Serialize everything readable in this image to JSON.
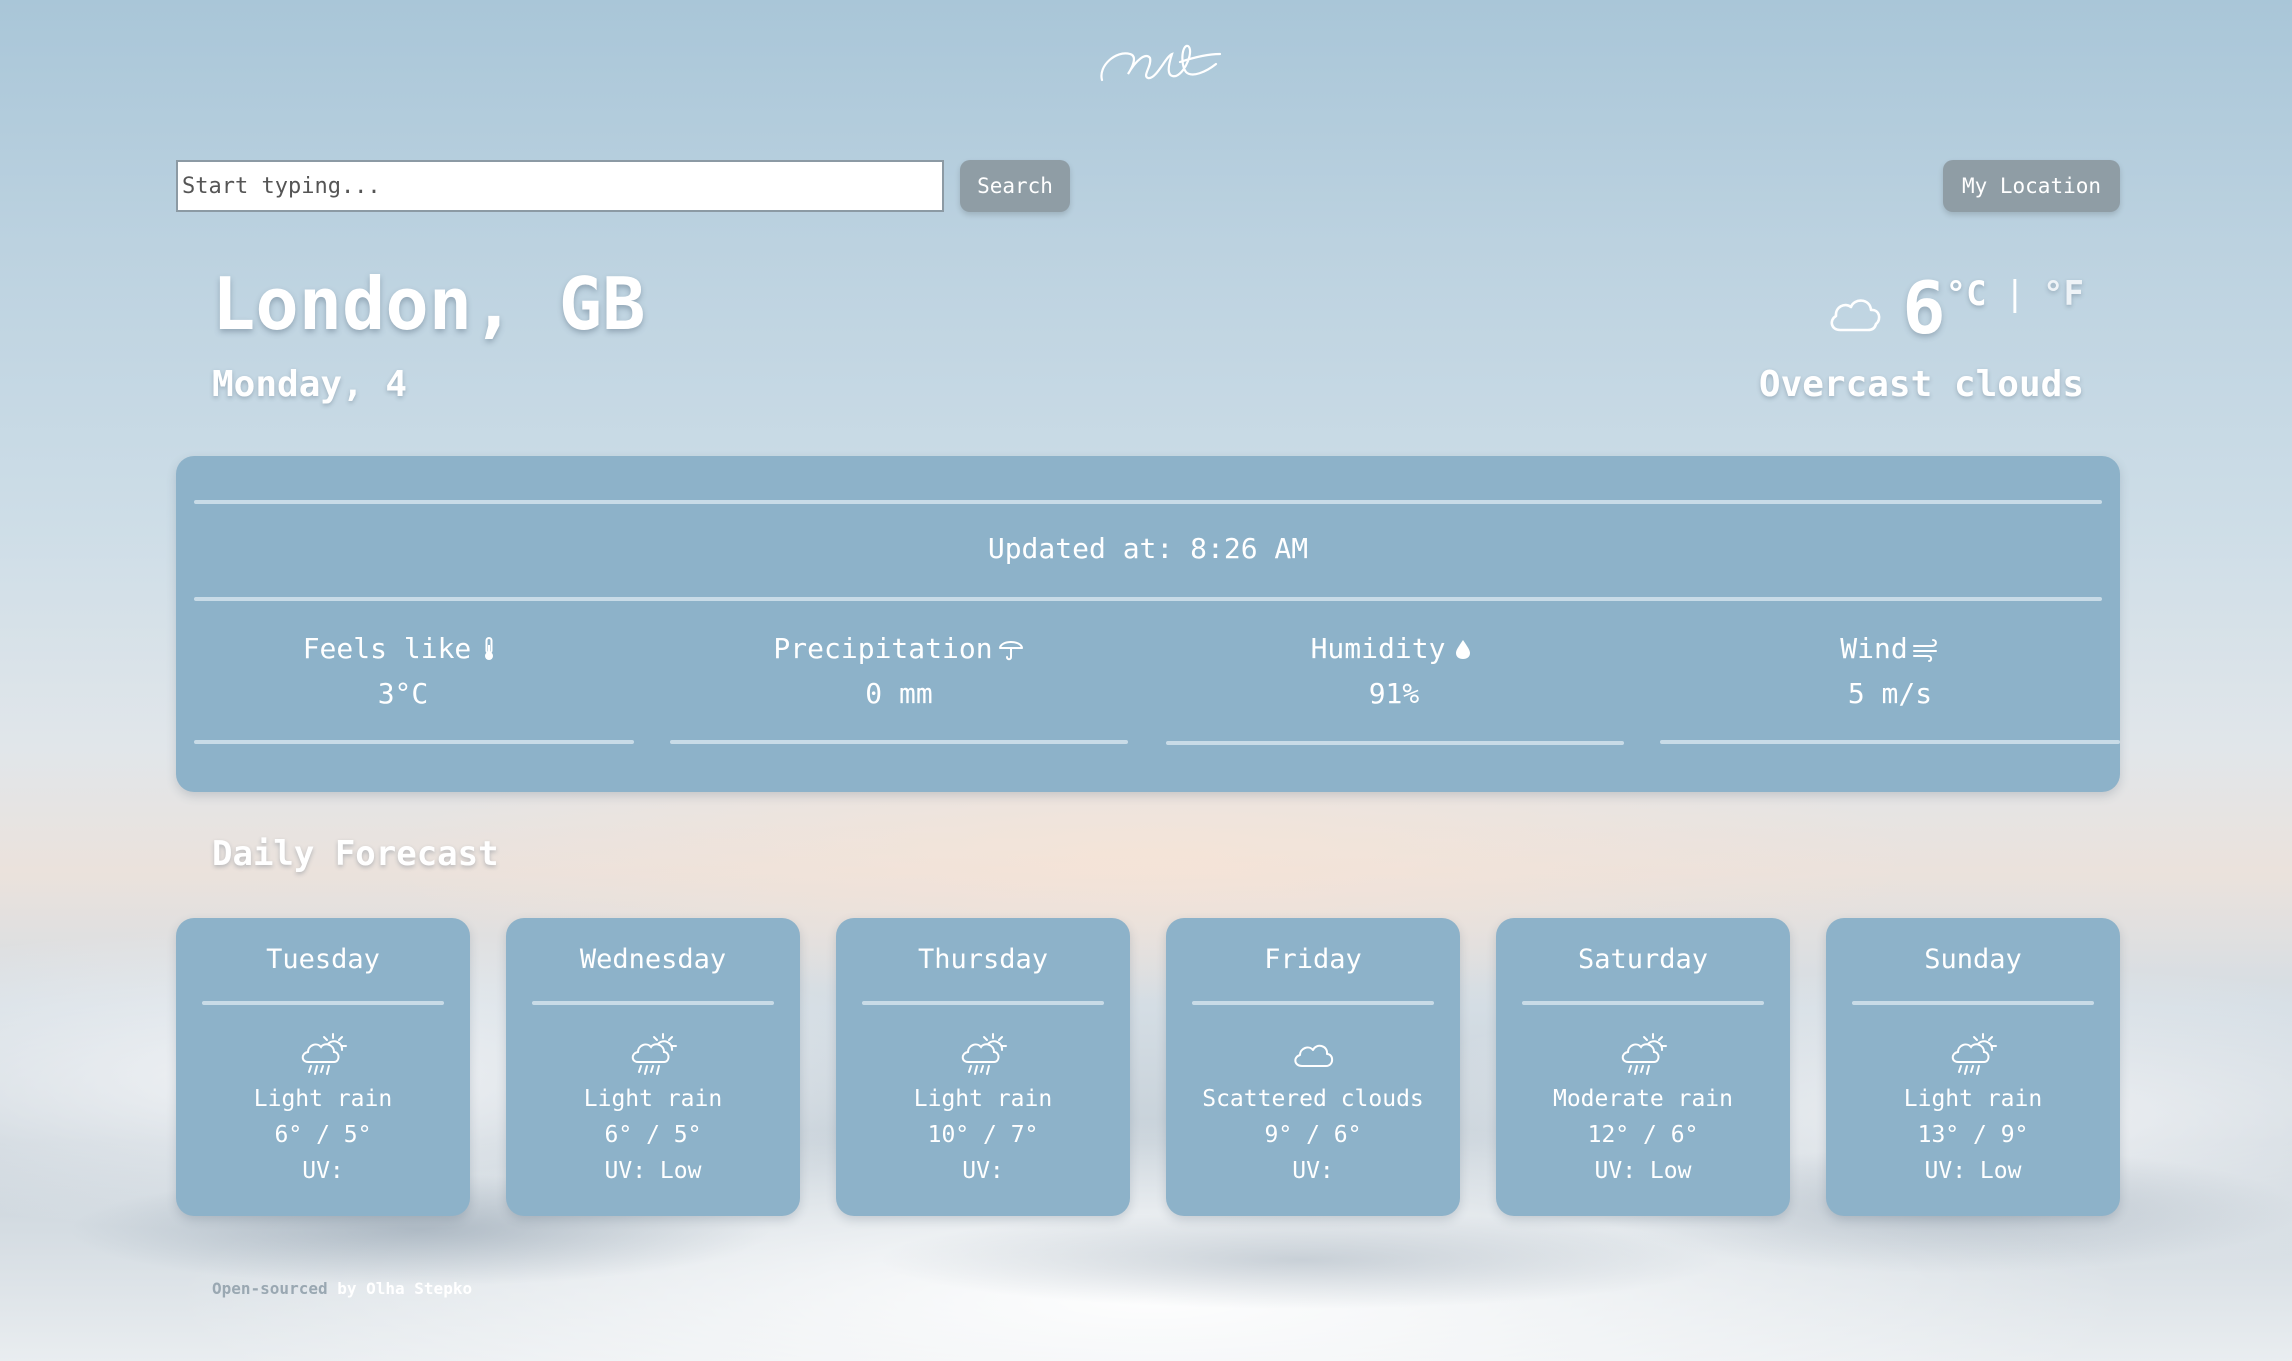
{
  "search": {
    "placeholder": "Start typing...",
    "button_label": "Search"
  },
  "location_button_label": "My Location",
  "location": {
    "city": "London, GB",
    "date": "Monday, 4"
  },
  "current": {
    "icon": "cloud-icon",
    "temperature": "6",
    "unit_c": "°C",
    "separator": "|",
    "unit_f": "°F",
    "description": "Overcast clouds"
  },
  "details": {
    "updated": "Updated at: 8:26 AM",
    "stats": [
      {
        "label": "Feels like",
        "value": "3°C",
        "icon": "thermometer-icon"
      },
      {
        "label": "Precipitation",
        "value": "0 mm",
        "icon": "umbrella-icon"
      },
      {
        "label": "Humidity",
        "value": "91%",
        "icon": "droplet-icon"
      },
      {
        "label": "Wind",
        "value": "5 m/s",
        "icon": "wind-icon"
      }
    ]
  },
  "forecast": {
    "title": "Daily Forecast",
    "days": [
      {
        "day": "Tuesday",
        "icon": "sun-rain-icon",
        "condition": "Light rain",
        "temps": "6° / 5°",
        "uv": "UV:"
      },
      {
        "day": "Wednesday",
        "icon": "sun-rain-icon",
        "condition": "Light rain",
        "temps": "6° / 5°",
        "uv": "UV: Low"
      },
      {
        "day": "Thursday",
        "icon": "sun-rain-icon",
        "condition": "Light rain",
        "temps": "10° / 7°",
        "uv": "UV:"
      },
      {
        "day": "Friday",
        "icon": "cloud-icon",
        "condition": "Scattered clouds",
        "temps": "9° / 6°",
        "uv": "UV:"
      },
      {
        "day": "Saturday",
        "icon": "sun-rain-icon",
        "condition": "Moderate rain",
        "temps": "12° / 6°",
        "uv": "UV: Low"
      },
      {
        "day": "Sunday",
        "icon": "sun-rain-icon",
        "condition": "Light rain",
        "temps": "13° / 9°",
        "uv": "UV: Low"
      }
    ]
  },
  "footer": {
    "link_text": "Open-sourced",
    "by_text": " by Olha Stepko"
  },
  "colors": {
    "panel": "#8db2c9",
    "button": "#8f9da5"
  }
}
